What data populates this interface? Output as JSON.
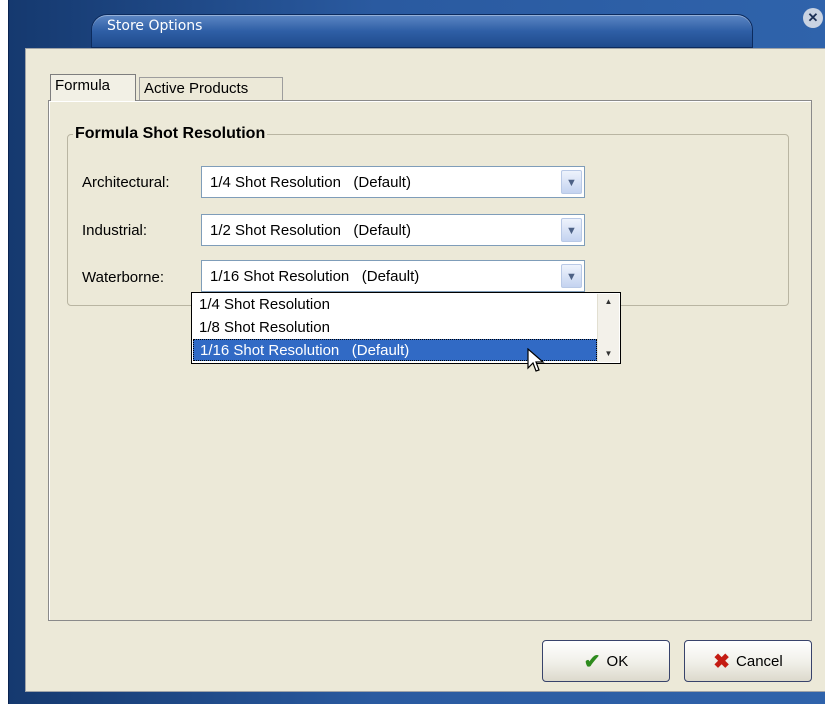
{
  "window": {
    "title": "Store Options",
    "close_glyph": "✕"
  },
  "tabs": [
    {
      "label": "Formula",
      "active": true
    },
    {
      "label": "Active Products",
      "active": false
    }
  ],
  "group": {
    "title": "Formula Shot Resolution"
  },
  "fields": [
    {
      "label": "Architectural:",
      "value": "1/4 Shot Resolution   (Default)"
    },
    {
      "label": "Industrial:",
      "value": "1/2 Shot Resolution   (Default)"
    },
    {
      "label": "Waterborne:",
      "value": "1/16 Shot Resolution   (Default)"
    }
  ],
  "dropdown": {
    "items": [
      {
        "label": "1/4 Shot Resolution"
      },
      {
        "label": "1/8 Shot Resolution"
      },
      {
        "label": "1/16 Shot Resolution   (Default)",
        "selected": true
      }
    ]
  },
  "buttons": {
    "ok_label": "OK",
    "cancel_label": "Cancel"
  },
  "icons": {
    "combo_arrow": "chevron-down-icon",
    "ok": "checkmark-icon",
    "cancel": "x-icon"
  },
  "colors": {
    "title_bar": "#2a5aa0",
    "dialog_bg": "#ece9d8",
    "selection": "#316ac5",
    "ok_green": "#2e8b1d",
    "cancel_red": "#c41b12"
  }
}
